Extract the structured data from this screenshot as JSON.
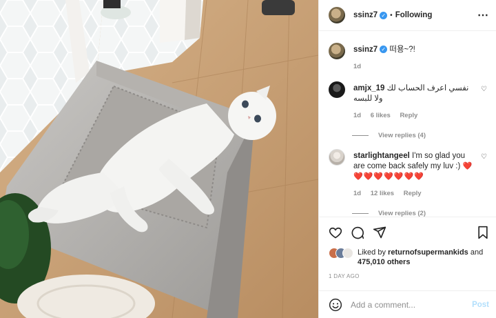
{
  "header": {
    "username": "ssinz7",
    "separator": "•",
    "follow_status": "Following",
    "more_icon": "more-horizontal-icon"
  },
  "caption": {
    "username": "ssinz7",
    "text": "떠용~?!",
    "age": "1d"
  },
  "comments": [
    {
      "username": "amjx_19",
      "text": "نفسي اعرف الحساب لك ولا للبسه",
      "age": "1d",
      "likes": "6 likes",
      "reply_label": "Reply",
      "view_replies": "View replies (4)"
    },
    {
      "username": "starlightangeel",
      "text": "I'm so glad you are come back safely my luv :)",
      "hearts": "❤️❤️❤️❤️❤️❤️❤️❤️",
      "age": "1d",
      "likes": "12 likes",
      "reply_label": "Reply",
      "view_replies": "View replies (2)"
    }
  ],
  "actions": {
    "icons": [
      "heart-icon",
      "comment-icon",
      "share-icon",
      "bookmark-icon"
    ]
  },
  "likes": {
    "prefix": "Liked by",
    "user": "returnofsupermankids",
    "joiner": "and",
    "others": "475,010 others"
  },
  "timestamp": "1 DAY AGO",
  "add_comment": {
    "placeholder": "Add a comment...",
    "post_label": "Post"
  },
  "colors": {
    "link_blue": "#3897f0",
    "post_disabled": "#b2dffc",
    "muted": "#8e8e8e",
    "heart_red": "#ed4956"
  }
}
